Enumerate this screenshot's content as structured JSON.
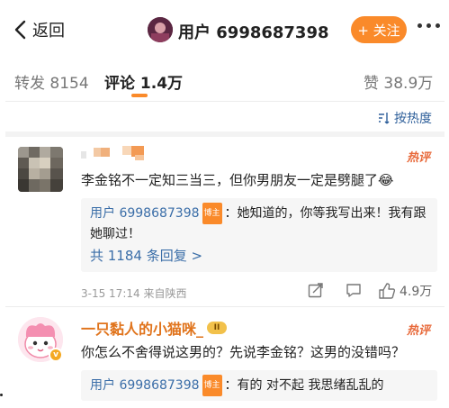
{
  "header": {
    "back_label": "返回",
    "title": "用户 6998687398",
    "follow_label": "+ 关注"
  },
  "tabs": {
    "repost_label": "转发",
    "repost_count": "8154",
    "comment_label": "评论",
    "comment_count": "1.4万",
    "like_label": "赞",
    "like_count": "38.9万"
  },
  "sort": {
    "label": "按热度"
  },
  "comments": [
    {
      "hot_label": "热评",
      "text": "李金铭不一定知三当三，但你男朋友一定是劈腿了😂",
      "reply": {
        "user": "用户 6998687398",
        "badge": "博主",
        "text_line1": "：她知道的，你等我写出来！我有跟",
        "text_line2": "她聊过！"
      },
      "replies_link": "共 1184 条回复 >",
      "meta": "3-15 17:14 来自陕西",
      "like_count": "4.9万"
    },
    {
      "user": "一只黏人的小猫咪_",
      "level": "II",
      "verified": "v",
      "hot_label": "热评",
      "text": "你怎么不舍得说这男的？先说李金铭？这男的没错吗？",
      "reply": {
        "user": "用户 6998687398",
        "badge": "博主",
        "text": "：有的 对不起 我思绪乱乱的"
      }
    }
  ],
  "colors": {
    "accent": "#fa8a2a",
    "link": "#3b6ea8",
    "hot": "#e86a3b"
  }
}
